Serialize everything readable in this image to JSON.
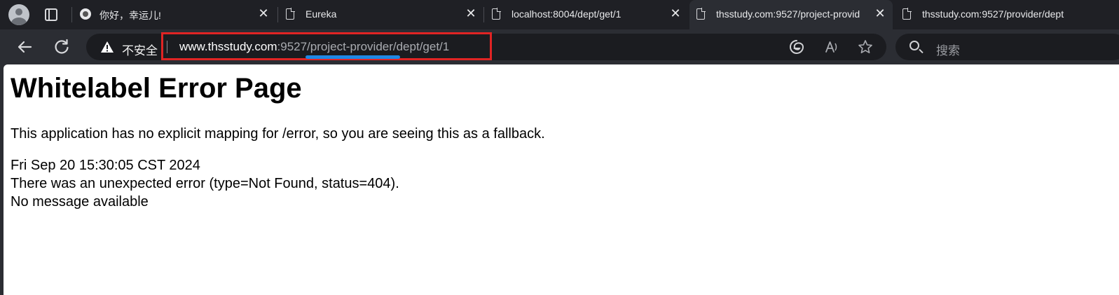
{
  "browser": {
    "tabs": [
      {
        "title": "你好，幸运儿!",
        "favicon": "round-avatar-icon"
      },
      {
        "title": "Eureka",
        "favicon": "document-icon"
      },
      {
        "title": "localhost:8004/dept/get/1",
        "favicon": "document-icon"
      },
      {
        "title": "thsstudy.com:9527/project-provid",
        "favicon": "document-icon",
        "active": true
      },
      {
        "title": "thsstudy.com:9527/provider/dept",
        "favicon": "document-icon"
      }
    ],
    "address_bar": {
      "security_label": "不安全",
      "url_host": "www.thsstudy.com",
      "url_rest": ":9527/project-provider/dept/get/1"
    },
    "search": {
      "placeholder": "搜索"
    },
    "highlight_color": "#e02424",
    "underline_color": "#1e88e5"
  },
  "page": {
    "title": "Whitelabel Error Page",
    "message": "This application has no explicit mapping for /error, so you are seeing this as a fallback.",
    "timestamp": "Fri Sep 20 15:30:05 CST 2024",
    "error": "There was an unexpected error (type=Not Found, status=404).",
    "detail": "No message available"
  }
}
